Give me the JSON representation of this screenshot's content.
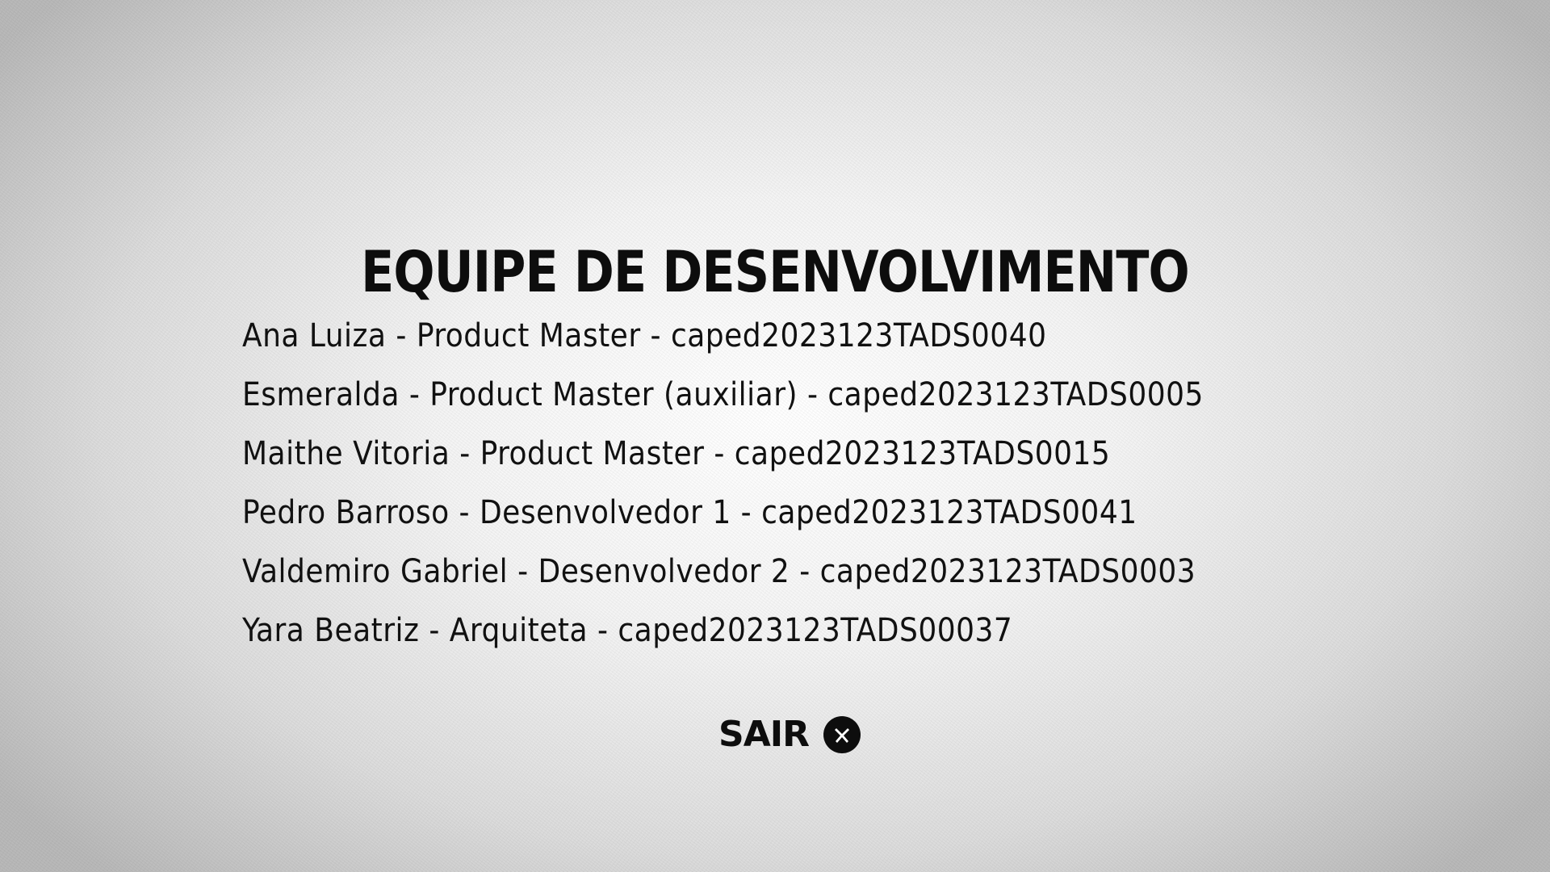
{
  "screen": {
    "title": "EQUIPE DE DESENVOLVIMENTO",
    "members": [
      "Ana Luiza - Product Master - caped2023123TADS0040",
      "Esmeralda - Product Master (auxiliar) - caped2023123TADS0005",
      "Maithe Vitoria - Product Master - caped2023123TADS0015",
      "Pedro Barroso - Desenvolvedor 1 - caped2023123TADS0041",
      "Valdemiro Gabriel - Desenvolvedor 2 - caped2023123TADS0003",
      "Yara Beatriz - Arquiteta - caped2023123TADS00037"
    ],
    "exit": {
      "label": "SAIR",
      "icon": "close-icon"
    }
  },
  "colors": {
    "text": "#111111",
    "background_center": "#ffffff",
    "background_edge": "#b9b9b9"
  }
}
